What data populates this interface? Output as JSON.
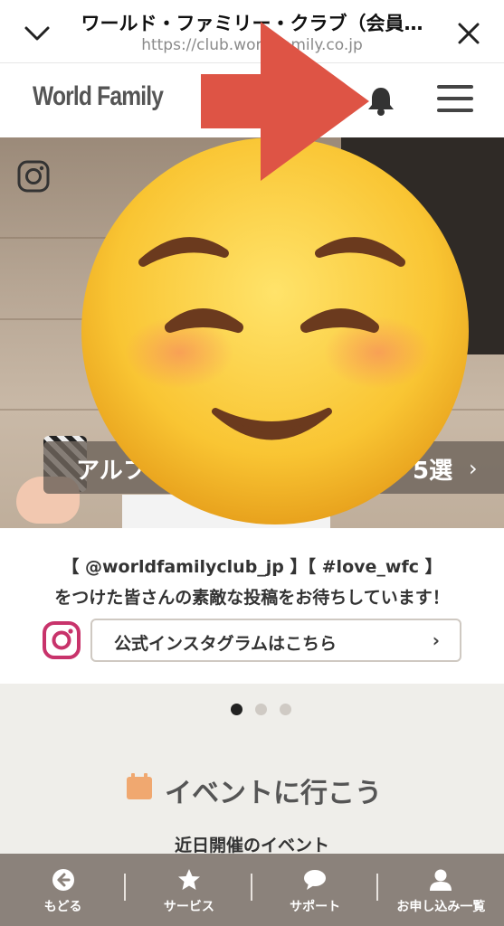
{
  "browser": {
    "page_title": "ワールド・ファミリー・クラブ（会員…",
    "url": "https://club.worldfamily.co.jp"
  },
  "header": {
    "logo_text": "World Family"
  },
  "hero": {
    "album_prefix": "アルフ",
    "album_suffix": "5選",
    "album_arrow": "›"
  },
  "caption": {
    "line1": "【 @worldfamilyclub_jp 】【 #love_wfc 】",
    "line2": "をつけた皆さんの素敵な投稿をお待ちしています！",
    "instagram_button_label": "公式インスタグラムはこちら",
    "instagram_button_chevron": "›"
  },
  "carousel": {
    "total": 3,
    "active_index": 0
  },
  "events": {
    "heading": "イベントに行こう",
    "subheading": "近日開催のイベント"
  },
  "bottom_nav": [
    {
      "label": "もどる",
      "icon": "back-arrow-icon"
    },
    {
      "label": "サービス",
      "icon": "star-icon"
    },
    {
      "label": "サポート",
      "icon": "chat-bubble-icon"
    },
    {
      "label": "お申し込み一覧",
      "icon": "user-icon"
    }
  ],
  "colors": {
    "nav_bg": "#8b827b",
    "gray_section": "#efeeea",
    "calendar_orange": "#f0a870",
    "instagram_pink": "#c8336b",
    "red_arrow": "#de5445"
  }
}
